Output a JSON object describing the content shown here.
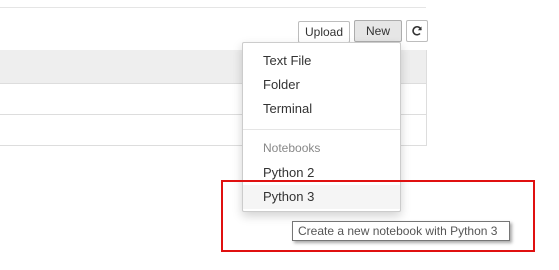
{
  "toolbar": {
    "upload_label": "Upload",
    "new_label": "New",
    "refresh_icon": "refresh-icon"
  },
  "new_menu": {
    "items": [
      {
        "label": "Text File"
      },
      {
        "label": "Folder"
      },
      {
        "label": "Terminal"
      }
    ],
    "notebooks_header": "Notebooks",
    "kernels": [
      {
        "label": "Python 2"
      },
      {
        "label": "Python 3",
        "hovered": true
      }
    ]
  },
  "tooltip": {
    "text": "Create a new notebook with Python 3"
  },
  "colors": {
    "highlight_border": "#e01010",
    "hover_background": "#f5f5f5"
  }
}
